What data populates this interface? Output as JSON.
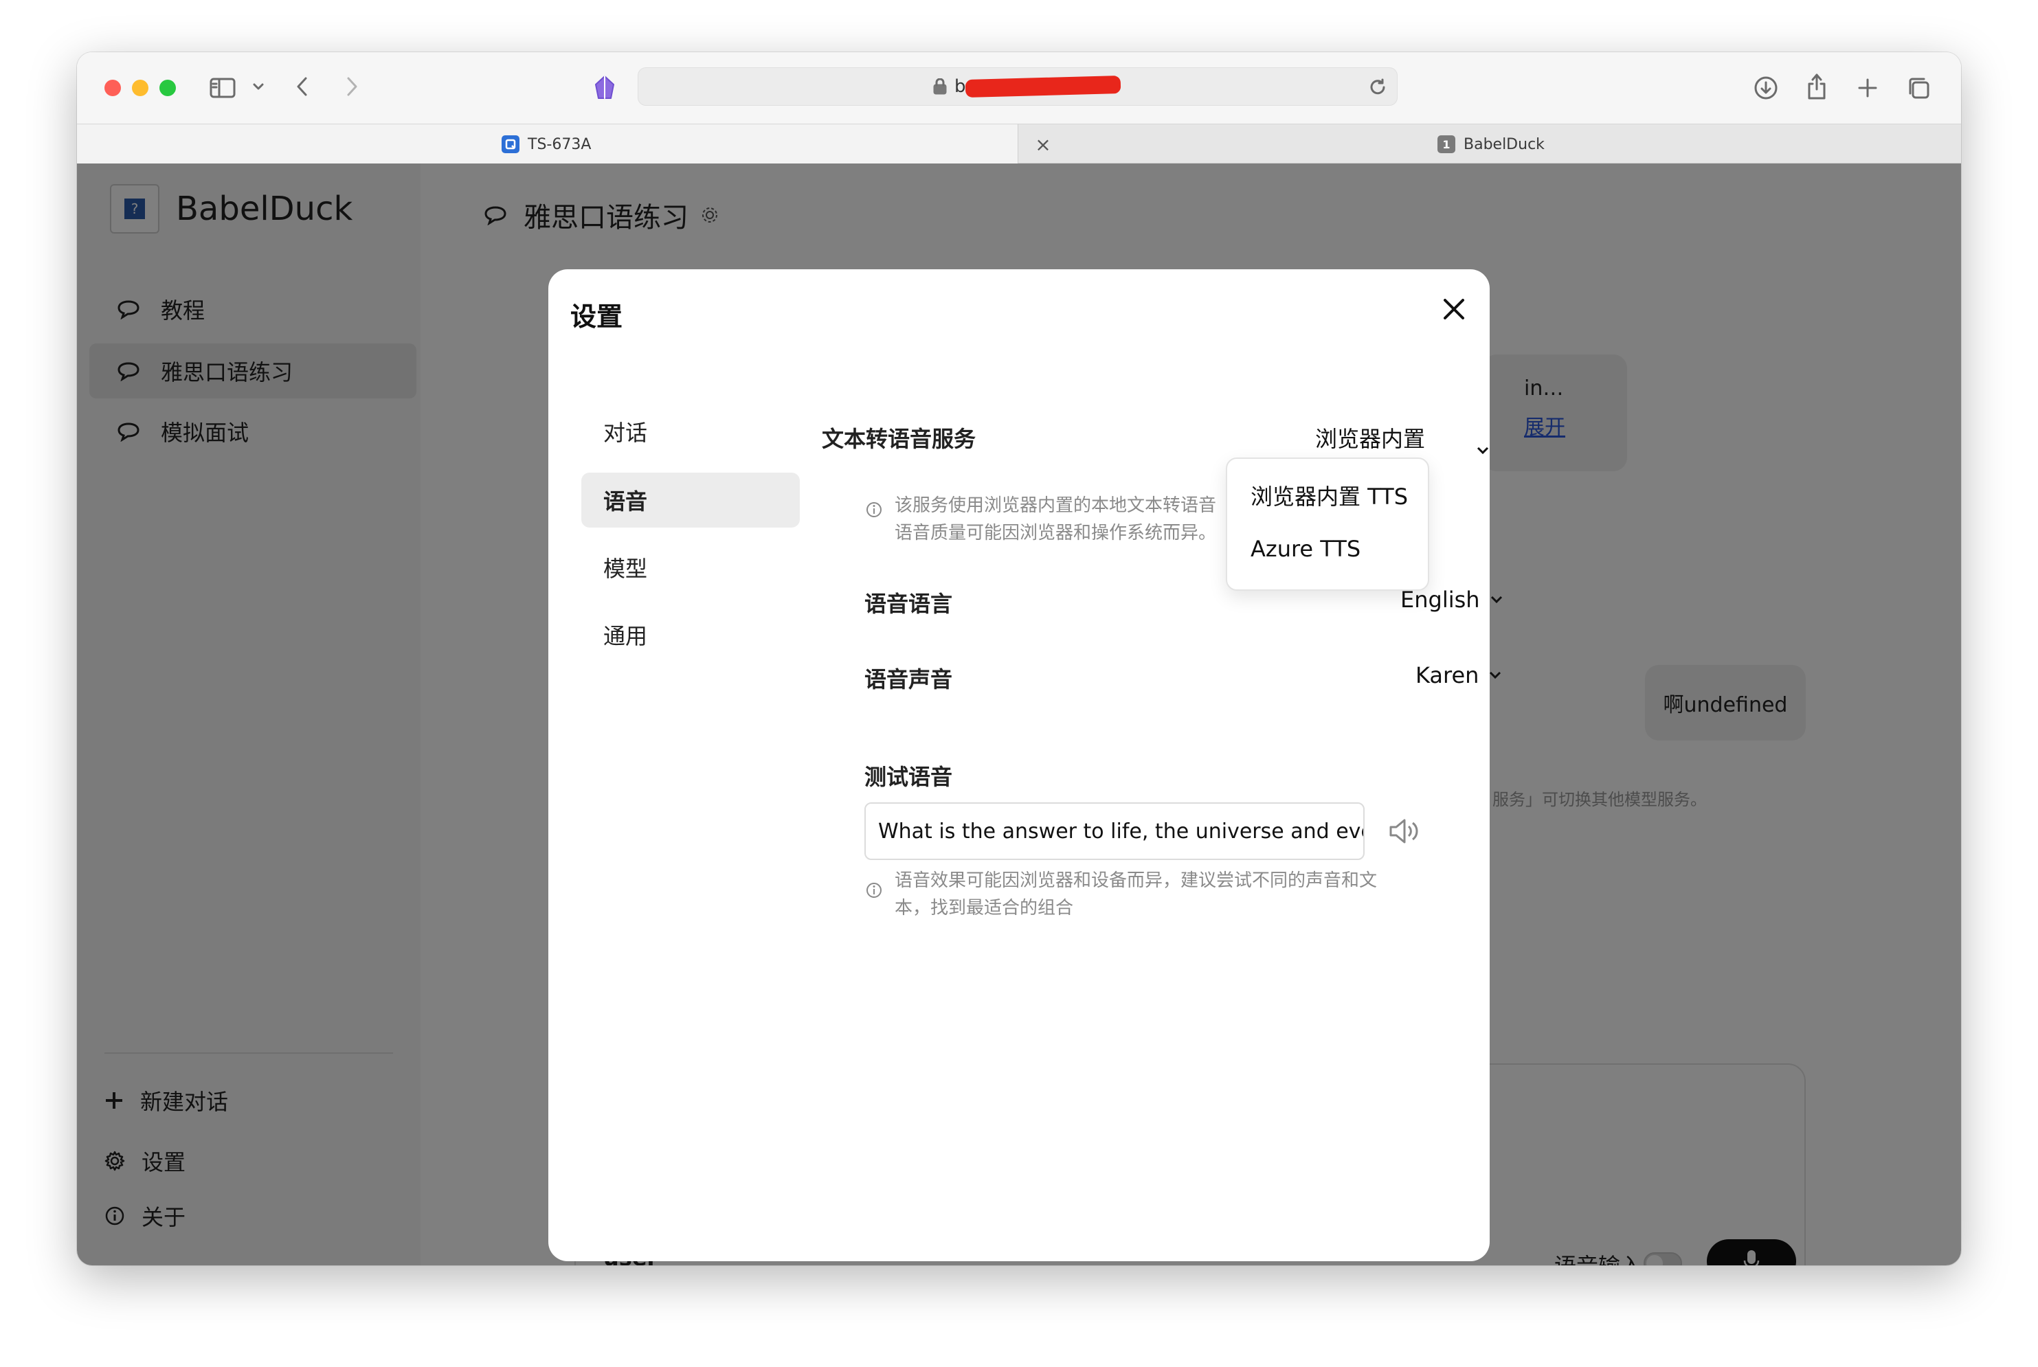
{
  "browser": {
    "address_text": "b",
    "tabs": [
      {
        "title": "TS-673A",
        "favicon_color": "#2c6fd6"
      },
      {
        "title": "BabelDuck",
        "favicon_text": "1",
        "favicon_color": "#7a7a7a"
      }
    ],
    "close_tab_symbol": "×"
  },
  "app": {
    "name": "BabelDuck",
    "logo_symbol": "?",
    "nav": [
      {
        "label": "教程",
        "icon": "chat-bubble-icon"
      },
      {
        "label": "雅思口语练习",
        "icon": "chat-bubble-icon",
        "active": true
      },
      {
        "label": "模拟面试",
        "icon": "chat-bubble-icon"
      }
    ],
    "bottom": [
      {
        "label": "新建对话",
        "icon": "plus-icon"
      },
      {
        "label": "设置",
        "icon": "gear-icon"
      },
      {
        "label": "关于",
        "icon": "info-icon"
      }
    ],
    "chat_title": "雅思口语练习",
    "bubble_preview_text": "in…",
    "bubble_expand_link": "展开",
    "user_bubble_text": "啊undefined",
    "hint_text": "服务」可切换其他模型服务。",
    "voice_input_label": "语音输入",
    "user_label": "user"
  },
  "modal": {
    "title": "设置",
    "tabs": [
      "对话",
      "语音",
      "模型",
      "通用"
    ],
    "active_tab": "语音",
    "tts_service_label": "文本转语音服务",
    "tts_service_value": "浏览器内置 TTS",
    "tts_info_line1": "该服务使用浏览器内置的本地文本转语音",
    "tts_info_line2": "语音质量可能因浏览器和操作系统而异。",
    "voice_language_label": "语音语言",
    "voice_language_value": "English",
    "voice_label": "语音声音",
    "voice_value": "Karen",
    "test_label": "测试语音",
    "test_input_value": "What is the answer to life, the universe and every",
    "test_info_line1": "语音效果可能因浏览器和设备而异，建议尝试不同的声音和文",
    "test_info_line2": "本，找到最适合的组合",
    "dropdown_options": [
      "浏览器内置 TTS",
      "Azure TTS"
    ]
  }
}
